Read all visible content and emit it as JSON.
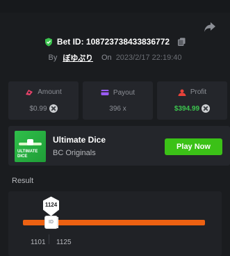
{
  "bet": {
    "id_text": "Bet ID: 108723738433836772",
    "by_label": "By",
    "username": "ぼゆぷり",
    "on_label": "On",
    "datetime": "2023/2/17 22:19:40"
  },
  "stats": {
    "amount": {
      "label": "Amount",
      "value": "$0.99",
      "icon": "money-icon"
    },
    "payout": {
      "label": "Payout",
      "value": "396 x",
      "icon": "wallet-icon"
    },
    "profit": {
      "label": "Profit",
      "value": "$394.99",
      "icon": "profit-icon"
    }
  },
  "game": {
    "name": "Ultimate Dice",
    "provider": "BC Originals",
    "thumb_line1": "ULTIMATE",
    "thumb_line2": "DICE",
    "play_label": "Play Now"
  },
  "result": {
    "label": "Result",
    "roll_value": "1124",
    "cube_text": "ID",
    "range_low": "1101",
    "range_high": "1125"
  },
  "colors": {
    "background": "#1a1c1f",
    "card": "#24262b",
    "accent_green": "#3bc117",
    "profit_green": "#3cc44f",
    "track_orange": "#ec6112",
    "icon_pink": "#e8426a",
    "icon_purple": "#9b5cf6",
    "icon_red": "#e8423a"
  }
}
